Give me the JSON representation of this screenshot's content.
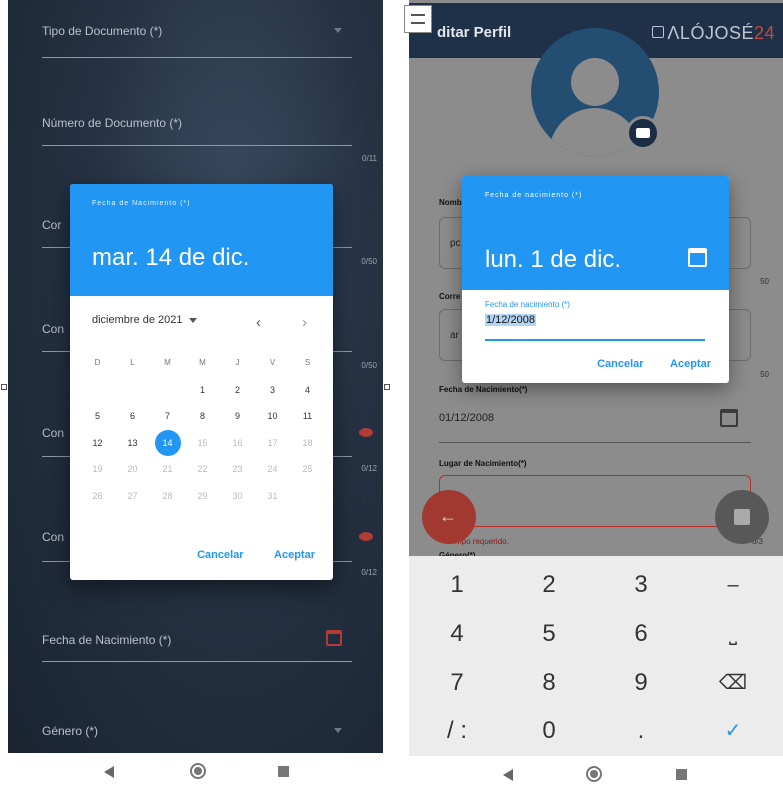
{
  "left": {
    "fields": {
      "tipo_documento": "Tipo de Documento (*)",
      "numero_documento": "Número de Documento (*)",
      "numero_counter": "0/11",
      "partial_labels": [
        "Cor",
        "Con",
        "Con",
        "Con"
      ],
      "counters": [
        "0/50",
        "0/50",
        "0/12",
        "0/12"
      ],
      "fecha_nacimiento": "Fecha de Nacimiento (*)",
      "genero": "Género (*)"
    },
    "dialog": {
      "subtitle": "Fecha de Nacimiento (*)",
      "big_date": "mar. 14 de dic.",
      "month_label": "diciembre de 2021",
      "prev": "‹",
      "next": "›",
      "weekdays": [
        "D",
        "L",
        "M",
        "M",
        "J",
        "V",
        "S"
      ],
      "weeks": [
        [
          "",
          "",
          "",
          "1",
          "2",
          "3",
          "4"
        ],
        [
          "5",
          "6",
          "7",
          "8",
          "9",
          "10",
          "11"
        ],
        [
          "12",
          "13",
          "14",
          "15",
          "16",
          "17",
          "18"
        ],
        [
          "19",
          "20",
          "21",
          "22",
          "23",
          "24",
          "25"
        ],
        [
          "26",
          "27",
          "28",
          "29",
          "30",
          "31",
          ""
        ]
      ],
      "selected_day": "14",
      "last_enabled_day": 14,
      "cancel": "Cancelar",
      "accept": "Aceptar"
    }
  },
  "right": {
    "appbar": {
      "title": "ditar Perfil",
      "logo_text": "ΛLÓJOSÉ",
      "logo_num": "24"
    },
    "labels": {
      "nombre": "Nomb",
      "nombre_value": "pc",
      "correo": "Corre",
      "correo_value": "ar",
      "counter1": "50",
      "counter2": "50",
      "fecha": "Fecha de Nacimiento(*)",
      "fecha_value": "01/12/2008",
      "lugar": "Lugar de Nacimiento(*)",
      "error": "mpo requerido.",
      "error_counter": "0/3",
      "genero": "Género(*)"
    },
    "dialog": {
      "subtitle": "Fecha de nacimiento (*)",
      "big_date": "lun. 1 de dic.",
      "field_label": "Fecha de nacimiento (*)",
      "field_value": "1/12/2008",
      "cancel": "Cancelar",
      "accept": "Aceptar"
    },
    "keyboard": {
      "rows": [
        [
          "1",
          "2",
          "3",
          "–"
        ],
        [
          "4",
          "5",
          "6",
          "⎵"
        ],
        [
          "7",
          "8",
          "9",
          "⌫"
        ],
        [
          "/ :",
          "0",
          ".",
          "✓"
        ]
      ]
    }
  },
  "colors": {
    "accent": "#2196f3",
    "appbar": "#1e3149",
    "error": "#b32f29"
  }
}
